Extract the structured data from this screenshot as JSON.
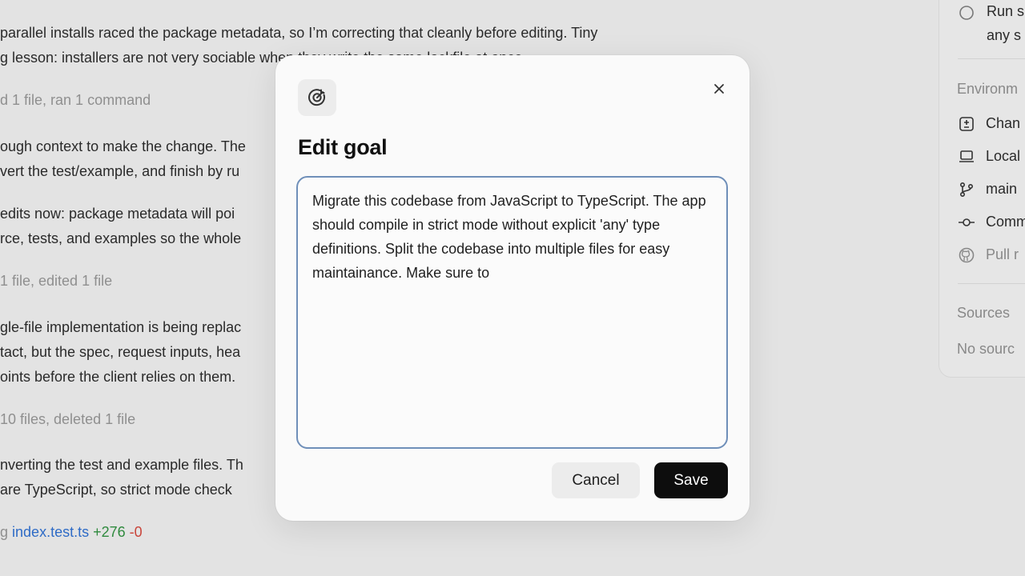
{
  "transcript": {
    "lines": [
      "parallel installs raced the package metadata, so I’m correcting that cleanly before editing. Tiny",
      "g lesson: installers are not very sociable when they write the same lockfile at once.",
      "d 1 file, ran 1 command",
      "ough context to make the change. The",
      "vert the test/example, and finish by ru",
      " edits now: package metadata will poi",
      "rce, tests, and examples so the whole",
      " 1 file, edited 1 file",
      "gle-file implementation is being replac",
      "tact, but the spec, request inputs, hea",
      "oints before the client relies on them.",
      " 10 files, deleted 1 file",
      "nverting the test and example files. Th",
      " are TypeScript, so strict mode check"
    ],
    "last_line_prefix": "g",
    "file_name": "index.test.ts",
    "additions": "+276",
    "deletions": "-0"
  },
  "right_panel": {
    "run_label": "Run s",
    "run_sub": "any s",
    "environment_heading": "Environm",
    "items": [
      "Chan",
      "Local",
      "main",
      "Comm",
      "Pull r"
    ],
    "sources_heading": "Sources",
    "no_sources": "No sourc"
  },
  "modal": {
    "title": "Edit goal",
    "goal_text": "Migrate this codebase from JavaScript to TypeScript. The app should compile in strict mode without explicit 'any' type definitions. Split the codebase into multiple files for easy maintainance. Make sure to",
    "cancel_label": "Cancel",
    "save_label": "Save",
    "icons": {
      "goal": "goal-target-icon",
      "close": "close-icon"
    },
    "colors": {
      "save_bg": "#0d0d0d",
      "textarea_border": "#6f8fb9"
    }
  }
}
